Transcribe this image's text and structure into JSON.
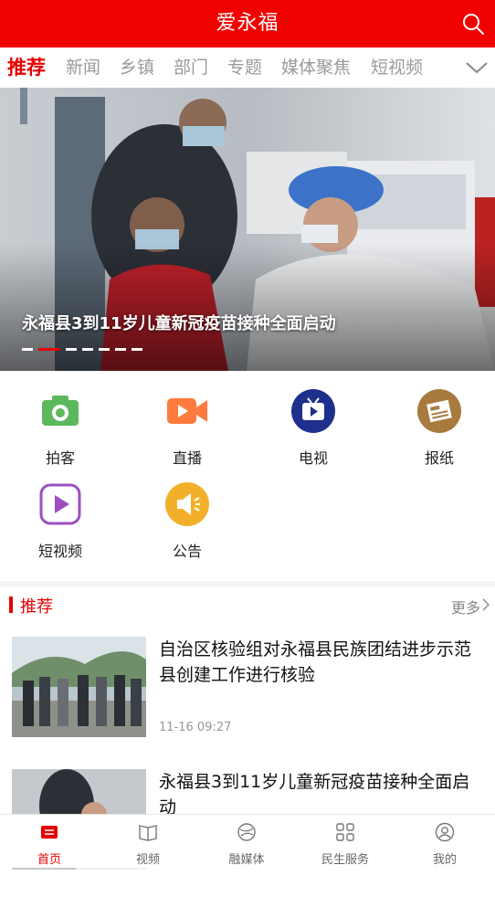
{
  "app": {
    "title": "爱永福"
  },
  "tabs": [
    "推荐",
    "新闻",
    "乡镇",
    "部门",
    "专题",
    "媒体聚焦",
    "短视频"
  ],
  "banner": {
    "caption": "永福县3到11岁儿童新冠疫苗接种全面启动"
  },
  "shortcuts": [
    {
      "label": "拍客",
      "icon": "camera-icon",
      "color": "#5cb85c"
    },
    {
      "label": "直播",
      "icon": "video-camera-icon",
      "color": "#ff7a3d"
    },
    {
      "label": "电视",
      "icon": "tv-icon",
      "color": "#1e2f8c"
    },
    {
      "label": "报纸",
      "icon": "newspaper-icon",
      "color": "#a87a3e"
    },
    {
      "label": "短视频",
      "icon": "play-icon",
      "color": "#9b4fbf"
    },
    {
      "label": "公告",
      "icon": "megaphone-icon",
      "color": "#f2b02a"
    }
  ],
  "section": {
    "title": "推荐",
    "more": "更多"
  },
  "news": [
    {
      "title": "自治区核验组对永福县民族团结进步示范县创建工作进行核验",
      "time": "11-16 09:27"
    },
    {
      "title": "永福县3到11岁儿童新冠疫苗接种全面启动",
      "time": ""
    }
  ],
  "bottom_nav": [
    "首页",
    "视频",
    "融媒体",
    "民生服务",
    "我的"
  ],
  "colors": {
    "brand": "#f10000",
    "accent": "#e60000"
  }
}
